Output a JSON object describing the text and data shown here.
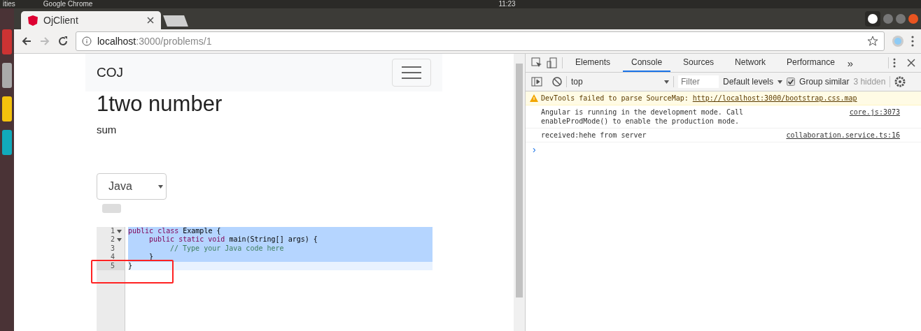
{
  "system_bar": {
    "left": "ities",
    "app": "Google Chrome",
    "clock": "11:23"
  },
  "browser": {
    "tab_title": "OjClient",
    "url_host": "localhost",
    "url_path": ":3000/problems/1"
  },
  "page": {
    "brand": "COJ",
    "title": "1two number",
    "description": "sum",
    "language": "Java",
    "editor": {
      "lines": [
        {
          "number": "1",
          "fold": true,
          "selected": true,
          "tokens": [
            {
              "kind": "keyword",
              "text": "public class "
            },
            {
              "kind": "plain",
              "text": "Example {"
            }
          ]
        },
        {
          "number": "2",
          "fold": true,
          "selected": true,
          "kind": "inner",
          "tokens": [
            {
              "kind": "keyword",
              "text": "public static void "
            },
            {
              "kind": "plain",
              "text": "main(String[] args) {"
            }
          ]
        },
        {
          "number": "3",
          "fold": false,
          "selected": true,
          "kind": "inner2",
          "tokens": [
            {
              "kind": "comment",
              "text": "// Type your Java code here"
            }
          ]
        },
        {
          "number": "4",
          "fold": false,
          "selected": true,
          "kind": "inner",
          "tokens": [
            {
              "kind": "plain",
              "text": "}"
            }
          ]
        },
        {
          "number": "5",
          "fold": false,
          "selected": false,
          "tokens": [
            {
              "kind": "plain",
              "text": "}"
            }
          ]
        }
      ]
    }
  },
  "devtools": {
    "tabs": [
      {
        "label": "Elements",
        "selected": false
      },
      {
        "label": "Console",
        "selected": true
      },
      {
        "label": "Sources",
        "selected": false
      },
      {
        "label": "Network",
        "selected": false
      },
      {
        "label": "Performance",
        "selected": false
      }
    ],
    "more": "»",
    "context": "top",
    "filter_placeholder": "Filter",
    "levels": "Default levels",
    "group_similar": {
      "label": "Group similar",
      "checked": true
    },
    "hidden": "3 hidden",
    "messages": [
      {
        "kind": "warning",
        "text": "DevTools failed to parse SourceMap: ",
        "link": "http://localhost:3000/bootstrap.css.map"
      },
      {
        "kind": "log",
        "text": "Angular is running in the development mode. Call\nenableProdMode() to enable the production mode.",
        "source": "core.js:3073"
      },
      {
        "kind": "log",
        "text": "received:hehe from server",
        "source": "collaboration.service.ts:16"
      }
    ],
    "prompt": "›"
  }
}
